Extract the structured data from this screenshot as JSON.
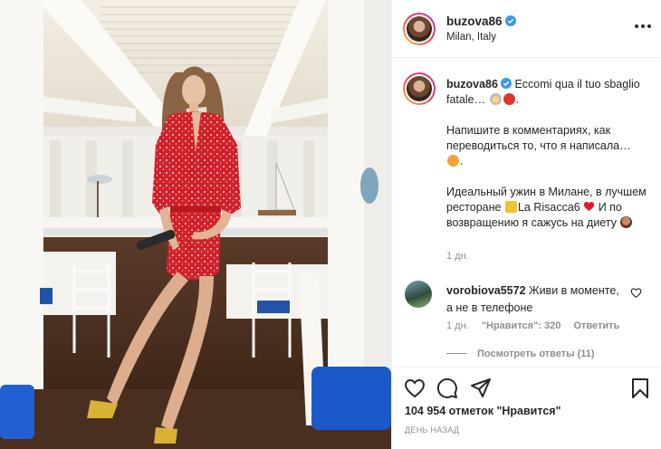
{
  "post": {
    "username": "buzova86",
    "location": "Milan, Italy"
  },
  "caption": {
    "username": "buzova86",
    "line1": "Eccomi qua il tuo sbaglio fatale…",
    "line2": "Напишите в комментариях, как переводиться то, что я написала…",
    "line3a": "Идеальный ужин в Милане, в лучшем ресторане",
    "line3b": "La Risacca6",
    "line3c": "И по возвращению я сажусь на диету",
    "time": "1 дн."
  },
  "reply": {
    "username": "vorobiova5572",
    "text": "Живи в моменте, а не в телефоне",
    "time": "1 дн.",
    "likes": "\"Нравится\": 320",
    "reply_label": "Ответить",
    "view_replies": "Посмотреть ответы (11)"
  },
  "footer": {
    "likes": "104 954 отметок \"Нравится\"",
    "posted": "День назад"
  },
  "icons": [
    "more-icon",
    "verified-badge-icon",
    "heart-icon",
    "comment-icon",
    "share-icon",
    "bookmark-icon"
  ],
  "colors": {
    "verified": "#3897f0",
    "dress": "#d0222a",
    "text_muted": "#8e8e8e",
    "divider": "#efefef"
  }
}
